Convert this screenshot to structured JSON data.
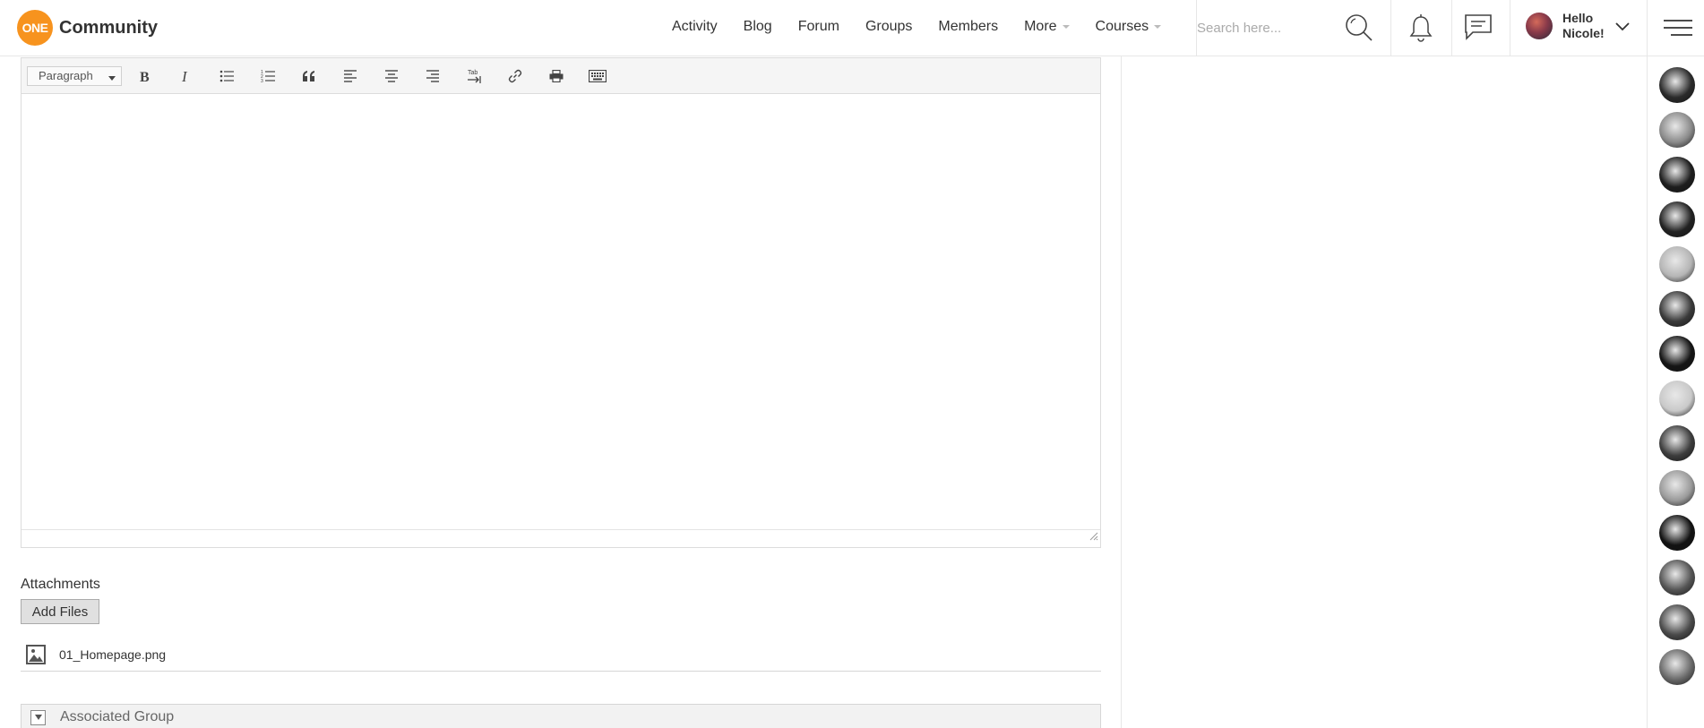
{
  "brand": {
    "badge": "ONE",
    "name": "Community"
  },
  "nav": {
    "items": [
      {
        "label": "Activity",
        "caret": false
      },
      {
        "label": "Blog",
        "caret": false
      },
      {
        "label": "Forum",
        "caret": false
      },
      {
        "label": "Groups",
        "caret": false
      },
      {
        "label": "Members",
        "caret": false
      },
      {
        "label": "More",
        "caret": true
      },
      {
        "label": "Courses",
        "caret": true
      }
    ]
  },
  "header": {
    "search_placeholder": "Search here...",
    "greeting_line1": "Hello",
    "greeting_line2": "Nicole!",
    "icons": [
      "search-icon",
      "bell-icon",
      "messages-icon",
      "chevron-down-icon",
      "menu-icon"
    ]
  },
  "editor": {
    "format_label": "Paragraph",
    "toolbar": [
      "bold-icon",
      "italic-icon",
      "bullet-list-icon",
      "numbered-list-icon",
      "blockquote-icon",
      "align-left-icon",
      "align-center-icon",
      "align-right-icon",
      "tab-icon",
      "link-icon",
      "print-icon",
      "keyboard-icon"
    ],
    "tab_glyph": "Tab",
    "content": ""
  },
  "attachments": {
    "title": "Attachments",
    "add_button": "Add Files",
    "files": [
      {
        "name": "01_Homepage.png",
        "icon": "image-icon"
      }
    ]
  },
  "associated_group": {
    "label": "Associated Group"
  },
  "members_sidebar": {
    "avatars": [
      {
        "tone": "#2b2b2b"
      },
      {
        "tone": "#8a8a8a"
      },
      {
        "tone": "#1e1e1e"
      },
      {
        "tone": "#222222"
      },
      {
        "tone": "#b5b5b5"
      },
      {
        "tone": "#3a3a3a"
      },
      {
        "tone": "#151515"
      },
      {
        "tone": "#c9c9c9"
      },
      {
        "tone": "#3d3d3d"
      },
      {
        "tone": "#9a9a9a"
      },
      {
        "tone": "#121212"
      },
      {
        "tone": "#555555"
      },
      {
        "tone": "#4a4a4a"
      },
      {
        "tone": "#6a6a6a"
      }
    ]
  },
  "colors": {
    "accent": "#f7931e",
    "text": "#333333",
    "border": "#e7e7e7"
  }
}
